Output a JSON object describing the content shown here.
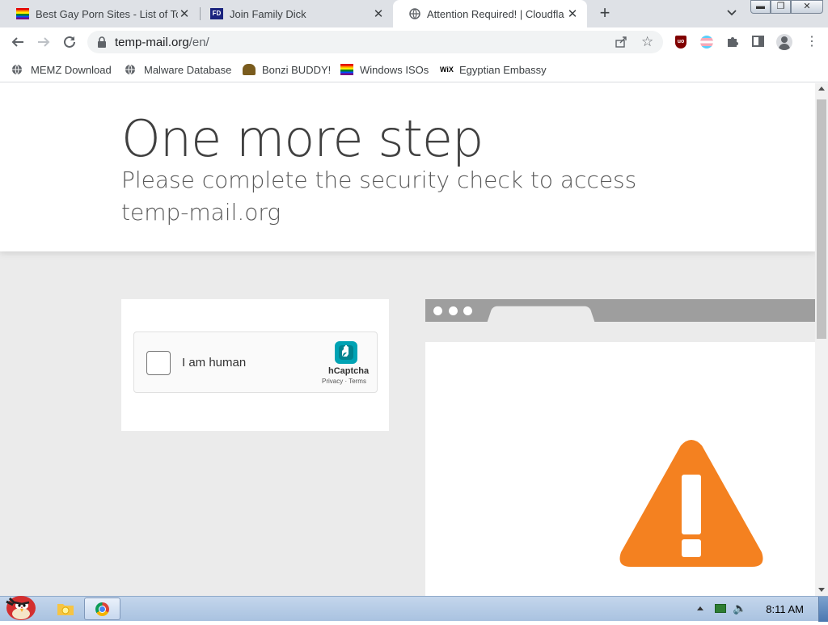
{
  "tabs": [
    {
      "title": "Best Gay Porn Sites - List of To",
      "favicon": "rainbow-flag-icon"
    },
    {
      "title": "Join Family Dick",
      "favicon": "fd-logo-icon"
    },
    {
      "title": "Attention Required! | Cloudfla",
      "favicon": "globe-icon",
      "active": true
    }
  ],
  "toolbar": {
    "url_host": "temp-mail.org",
    "url_path": "/en/"
  },
  "bookmarks": [
    {
      "label": "MEMZ Download",
      "icon": "globe-icon"
    },
    {
      "label": "Malware Database",
      "icon": "globe-icon"
    },
    {
      "label": "Bonzi BUDDY!",
      "icon": "bonzi-icon"
    },
    {
      "label": "Windows ISOs",
      "icon": "rainbow-flag-icon"
    },
    {
      "label": "Egyptian Embassy",
      "icon": "wix-icon"
    }
  ],
  "page": {
    "heading": "One more step",
    "subheading": "Please complete the security check to access temp-mail.org",
    "captcha": {
      "label": "I am human",
      "brand": "hCaptcha",
      "links": "Privacy · Terms"
    }
  },
  "taskbar": {
    "clock": "8:11 AM"
  },
  "colors": {
    "warning_orange": "#f48120",
    "hcaptcha_teal": "#00838f"
  }
}
